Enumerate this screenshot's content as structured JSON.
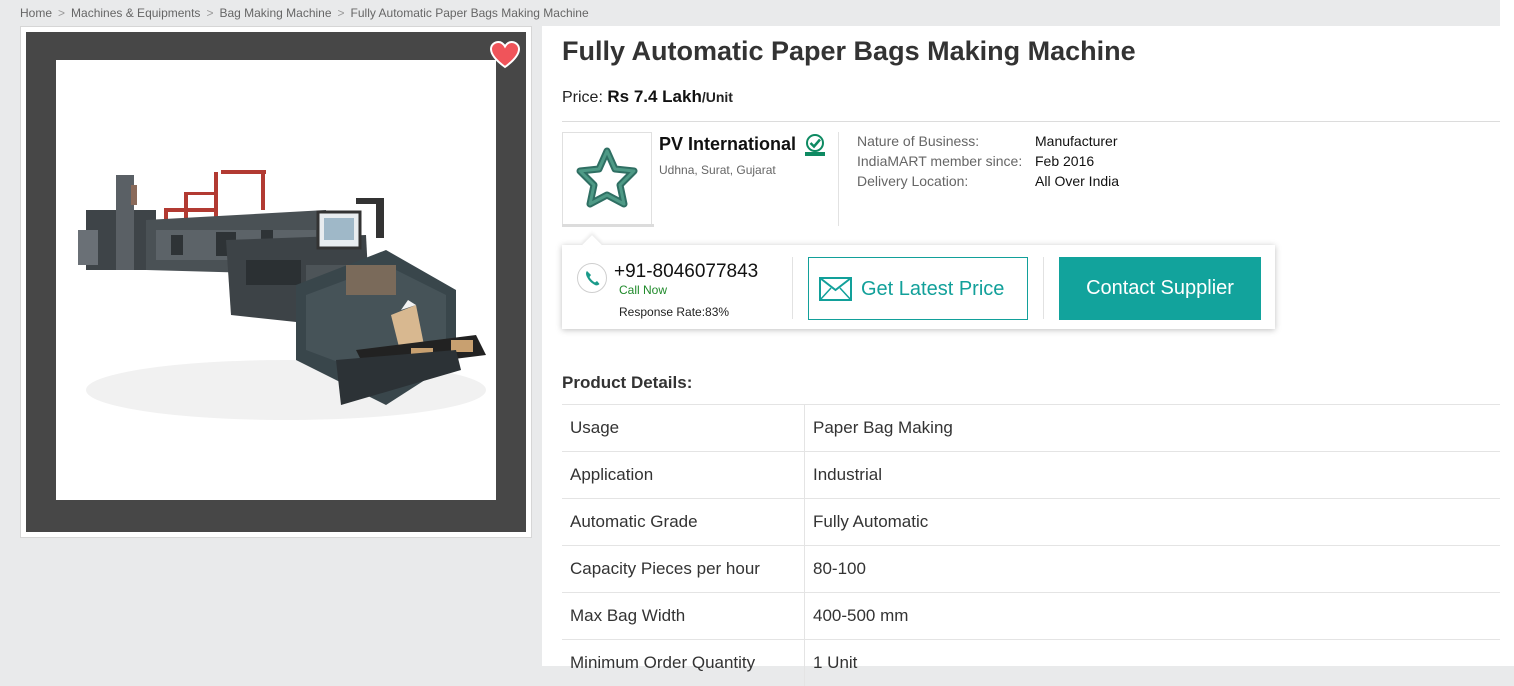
{
  "breadcrumb": [
    "Home",
    "Machines & Equipments",
    "Bag Making Machine",
    "Fully Automatic Paper Bags Making Machine"
  ],
  "product": {
    "title": "Fully Automatic Paper Bags Making Machine",
    "price_label": "Price:",
    "price_value": "Rs 7.4 Lakh",
    "price_unit": "/Unit"
  },
  "supplier": {
    "name": "PV International",
    "location": "Udhna, Surat, Gujarat",
    "meta": [
      {
        "label": "Nature of Business:",
        "value": "Manufacturer"
      },
      {
        "label": "IndiaMART member since:",
        "value": "Feb 2016"
      },
      {
        "label": "Delivery Location:",
        "value": "All Over India"
      }
    ]
  },
  "contact": {
    "phone": "+91-8046077843",
    "call_now": "Call Now",
    "response_rate": "Response Rate:83%",
    "get_price_label": "Get Latest Price",
    "contact_label": "Contact Supplier"
  },
  "details": {
    "heading": "Product Details:",
    "rows": [
      {
        "key": "Usage",
        "value": "Paper Bag Making"
      },
      {
        "key": "Application",
        "value": "Industrial"
      },
      {
        "key": "Automatic Grade",
        "value": "Fully Automatic"
      },
      {
        "key": "Capacity Pieces per hour",
        "value": "80-100"
      },
      {
        "key": "Max Bag Width",
        "value": "400-500 mm"
      },
      {
        "key": "Minimum Order Quantity",
        "value": "1 Unit"
      }
    ]
  },
  "colors": {
    "accent": "#12a39c",
    "heart": "#f0545a",
    "verified": "#0e8a62"
  }
}
